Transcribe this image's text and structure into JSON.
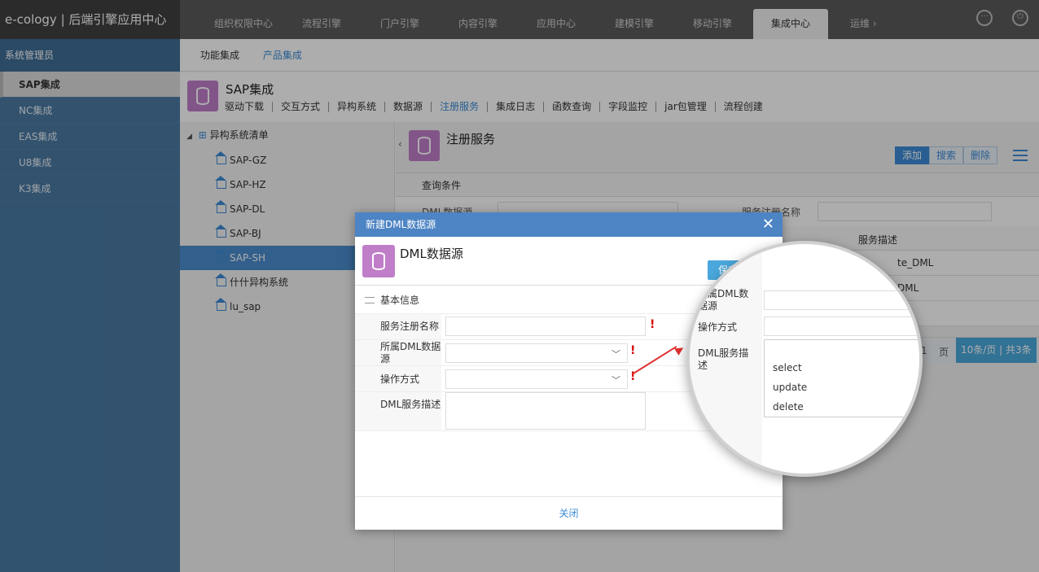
{
  "app": {
    "logo": "e-cology | 后端引擎应用中心"
  },
  "topnav": {
    "tabs": [
      "组织权限中心",
      "流程引擎",
      "门户引擎",
      "内容引擎",
      "应用中心",
      "建模引擎",
      "移动引擎",
      "集成中心"
    ],
    "active": "集成中心",
    "more": "运维 ›"
  },
  "sidebar": {
    "title": "系统管理员",
    "items": [
      "SAP集成",
      "NC集成",
      "EAS集成",
      "U8集成",
      "K3集成"
    ]
  },
  "subnav": {
    "items": [
      "功能集成",
      "产品集成"
    ]
  },
  "app_header": {
    "title": "SAP集成",
    "tabs": [
      "驱动下载",
      "交互方式",
      "异构系统",
      "数据源",
      "注册服务",
      "集成日志",
      "函数查询",
      "字段监控",
      "jar包管理",
      "流程创建"
    ]
  },
  "tree": {
    "root": "异构系统清单",
    "items": [
      "SAP-GZ",
      "SAP-HZ",
      "SAP-DL",
      "SAP-BJ",
      "SAP-SH",
      "什什异构系统",
      "lu_sap"
    ]
  },
  "register": {
    "title": "注册服务",
    "buttons": {
      "add": "添加",
      "search": "搜索",
      "delete": "删除"
    },
    "query_title": "查询条件",
    "q_label1": "DML数据源",
    "q_label2": "服务注册名称",
    "col_desc": "服务描述",
    "row1_desc": "te_DML",
    "row2_desc": "DML",
    "pager_page_num": "1",
    "pager_page": "页",
    "pager_size": "10条/页 | 共3条"
  },
  "dialog": {
    "title": "新建DML数据源",
    "close": "✕",
    "heading": "DML数据源",
    "save": "保存",
    "section": "基本信息",
    "fields": {
      "name": "服务注册名称",
      "ds": "所属DML数据源",
      "op": "操作方式",
      "desc": "DML服务描述"
    },
    "required_mark": "!",
    "footer_close": "关闭"
  },
  "zoom": {
    "ds": "所属DML数据源",
    "op": "操作方式",
    "desc": "DML服务描述",
    "options": [
      "select",
      "update",
      "delete"
    ]
  },
  "colors": {
    "accent": "#3b8bd6",
    "sidebar": "#4a7aa3",
    "dialog_title": "#4d84c4",
    "required": "#d60000",
    "icon_purple": "#c07ec9"
  }
}
